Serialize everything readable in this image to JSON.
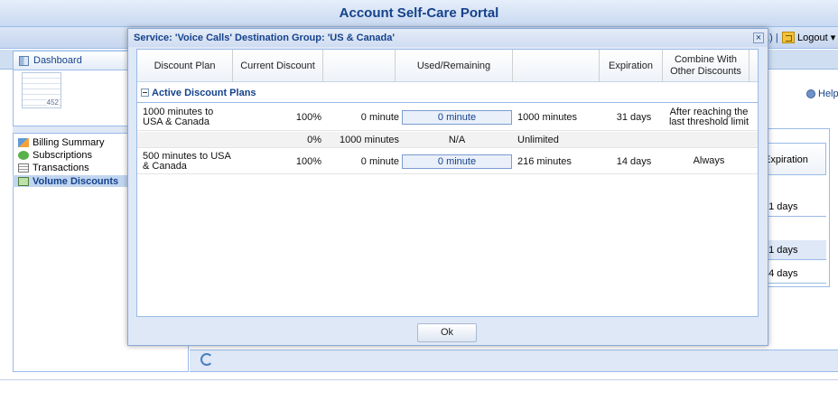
{
  "app": {
    "title": "Account Self-Care Portal",
    "user_suffix": "1) |",
    "logout_label": "Logout ▾",
    "help_label": "Help",
    "tabs": [
      {
        "label": "Dashboard"
      }
    ],
    "doc_badge": "452",
    "nav": [
      {
        "label": "Billing Summary",
        "icon": "billing-icon",
        "active": false
      },
      {
        "label": "Subscriptions",
        "icon": "subscriptions-icon",
        "active": false
      },
      {
        "label": "Transactions",
        "icon": "transactions-icon",
        "active": false
      },
      {
        "label": "Volume Discounts",
        "icon": "volume-discounts-icon",
        "active": true
      }
    ],
    "background_grid": {
      "header": "Expiration",
      "cells": [
        "31 days",
        "31 days",
        "14 days"
      ]
    }
  },
  "modal": {
    "title": "Service: 'Voice Calls' Destination Group: 'US & Canada'",
    "close_label": "×",
    "columns": [
      "Discount Plan",
      "Current Discount",
      "",
      "Used/Remaining",
      "",
      "Expiration",
      "Combine With Other Discounts"
    ],
    "group_label": "Active Discount Plans",
    "rows": [
      {
        "plan": "1000 minutes to USA & Canada",
        "current_discount": "100%",
        "used": "0 minute",
        "bar_label": "0 minute",
        "bar_fraction": 0.0,
        "remaining": "1000 minutes",
        "expiration": "31 days",
        "combine": "After reaching the last threshold limit"
      },
      {
        "plan": "",
        "current_discount": "0%",
        "used": "1000 minutes",
        "bar_label": "N/A",
        "remaining": "Unlimited",
        "expiration": "",
        "combine": ""
      },
      {
        "plan": "500 minutes to USA & Canada",
        "current_discount": "100%",
        "used": "0 minute",
        "bar_label": "0 minute",
        "bar_fraction": 0.0,
        "remaining": "216 minutes",
        "expiration": "14 days",
        "combine": "Always"
      }
    ],
    "ok_label": "Ok"
  }
}
